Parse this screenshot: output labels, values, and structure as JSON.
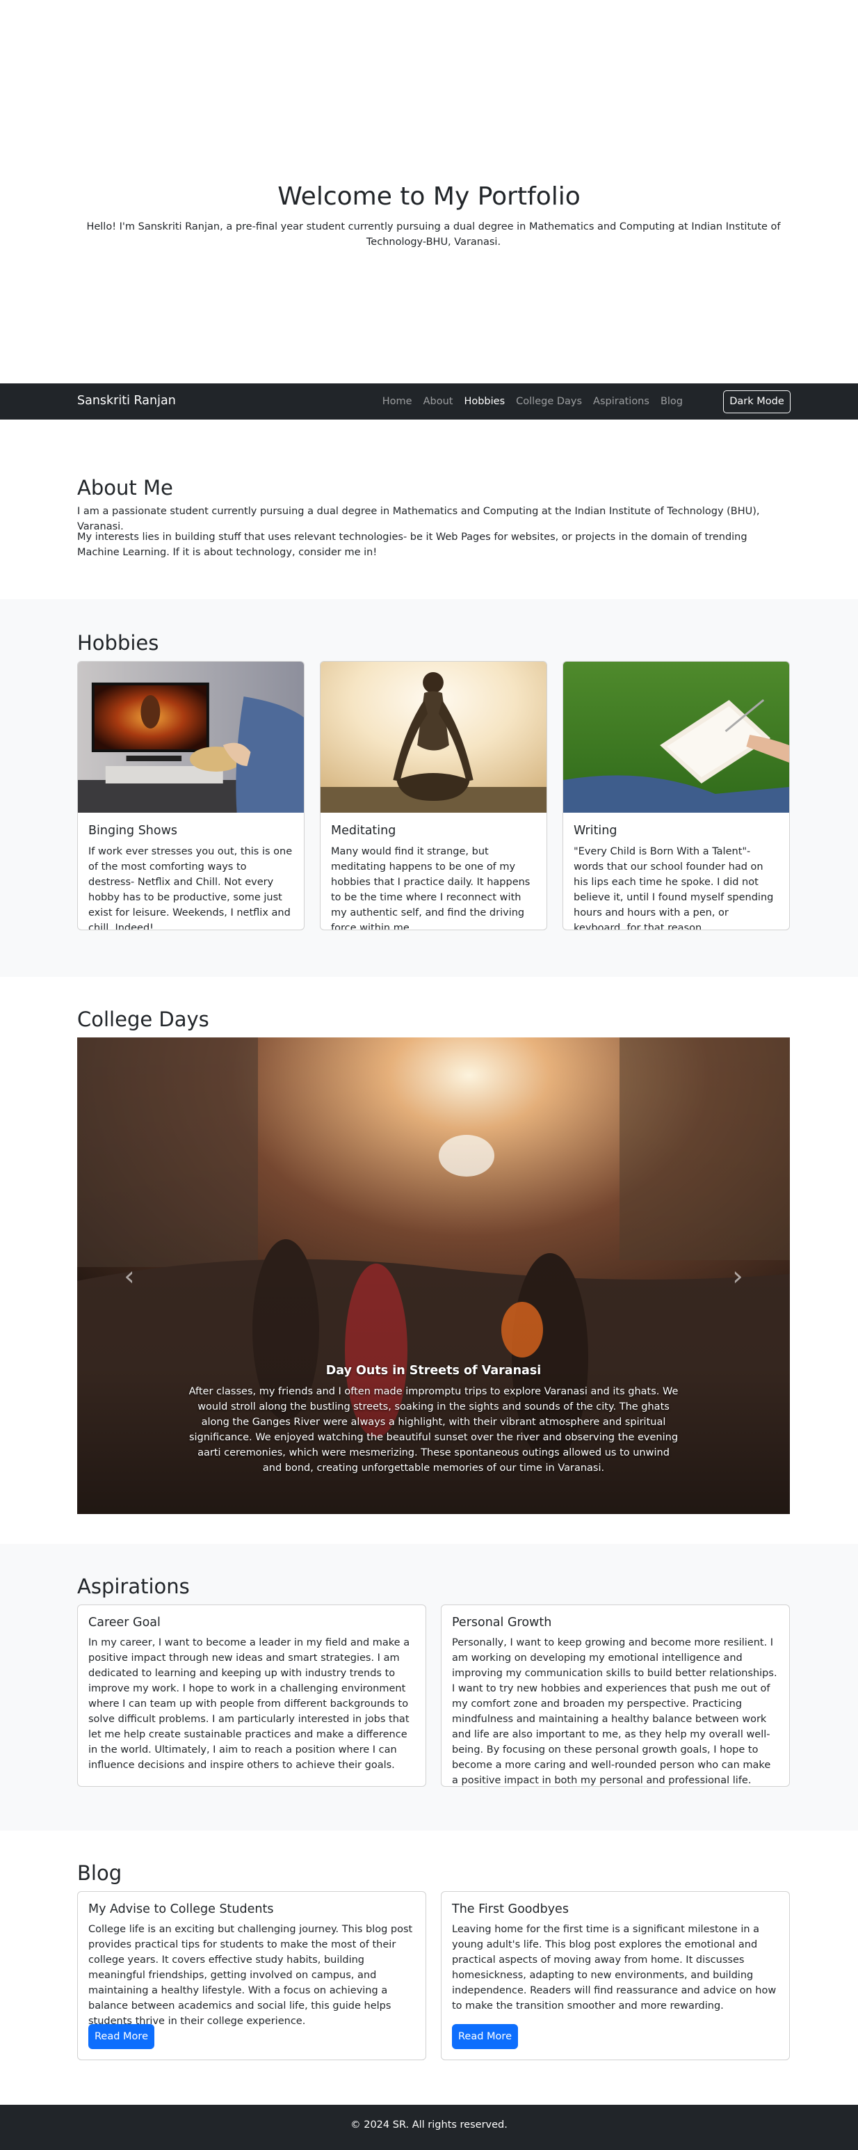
{
  "hero": {
    "title": "Welcome to My Portfolio",
    "subtitle": "Hello! I'm Sanskriti Ranjan, a pre-final year student currently pursuing a dual degree in Mathematics and Computing at Indian Institute of Technology-BHU, Varanasi."
  },
  "navbar": {
    "brand": "Sanskriti Ranjan",
    "links": [
      "Home",
      "About",
      "Hobbies",
      "College Days",
      "Aspirations",
      "Blog"
    ],
    "active": "Hobbies",
    "dark_mode_label": "Dark Mode"
  },
  "about": {
    "title": "About Me",
    "paragraphs": [
      "I am a passionate student currently pursuing a dual degree in Mathematics and Computing at the Indian Institute of Technology (BHU), Varanasi.",
      "My interests lies in building stuff that uses relevant technologies- be it Web Pages for websites, or projects in the domain of trending Machine Learning. If it is about technology, consider me in!"
    ]
  },
  "hobbies": {
    "title": "Hobbies",
    "cards": [
      {
        "title": "Binging Shows",
        "text": "If work ever stresses you out, this is one of the most comforting ways to destress- Netflix and Chill. Not every hobby has to be productive, some just exist for leisure. Weekends, I netflix and chill, Indeed!"
      },
      {
        "title": "Meditating",
        "text": "Many would find it strange, but meditating happens to be one of my hobbies that I practice daily. It happens to be the time where I reconnect with my authentic self, and find the driving force within me."
      },
      {
        "title": "Writing",
        "text": "\"Every Child is Born With a Talent\"- words that our school founder had on his lips each time he spoke. I did not believe it, until I found myself spending hours and hours with a pen, or keyboard, for that reason."
      }
    ]
  },
  "college": {
    "title": "College Days",
    "slide_title": "Day Outs in Streets of Varanasi",
    "slide_text": "After classes, my friends and I often made impromptu trips to explore Varanasi and its ghats. We would stroll along the bustling streets, soaking in the sights and sounds of the city. The ghats along the Ganges River were always a highlight, with their vibrant atmosphere and spiritual significance. We enjoyed watching the beautiful sunset over the river and observing the evening aarti ceremonies, which were mesmerizing. These spontaneous outings allowed us to unwind and bond, creating unforgettable memories of our time in Varanasi.",
    "prev_icon": "chevron-left-icon",
    "next_icon": "chevron-right-icon"
  },
  "aspirations": {
    "title": "Aspirations",
    "cards": [
      {
        "title": "Career Goal",
        "text": "In my career, I want to become a leader in my field and make a positive impact through new ideas and smart strategies. I am dedicated to learning and keeping up with industry trends to improve my work. I hope to work in a challenging environment where I can team up with people from different backgrounds to solve difficult problems. I am particularly interested in jobs that let me help create sustainable practices and make a difference in the world. Ultimately, I aim to reach a position where I can influence decisions and inspire others to achieve their goals."
      },
      {
        "title": "Personal Growth",
        "text": "Personally, I want to keep growing and become more resilient. I am working on developing my emotional intelligence and improving my communication skills to build better relationships. I want to try new hobbies and experiences that push me out of my comfort zone and broaden my perspective. Practicing mindfulness and maintaining a healthy balance between work and life are also important to me, as they help my overall well-being. By focusing on these personal growth goals, I hope to become a more caring and well-rounded person who can make a positive impact in both my personal and professional life."
      }
    ]
  },
  "blog": {
    "title": "Blog",
    "cards": [
      {
        "title": "My Advise to College Students",
        "text": "College life is an exciting but challenging journey. This blog post provides practical tips for students to make the most of their college years. It covers effective study habits, building meaningful friendships, getting involved on campus, and maintaining a healthy lifestyle. With a focus on achieving a balance between academics and social life, this guide helps students thrive in their college experience.",
        "button": "Read More"
      },
      {
        "title": "The First Goodbyes",
        "text": "Leaving home for the first time is a significant milestone in a young adult's life. This blog post explores the emotional and practical aspects of moving away from home. It discusses homesickness, adapting to new environments, and building independence. Readers will find reassurance and advice on how to make the transition smoother and more rewarding.",
        "button": "Read More"
      }
    ]
  },
  "footer": {
    "text": "© 2024 SR. All rights reserved."
  },
  "colors": {
    "dark": "#212529",
    "light": "#f8f9fa",
    "primary": "#0d6efd"
  }
}
